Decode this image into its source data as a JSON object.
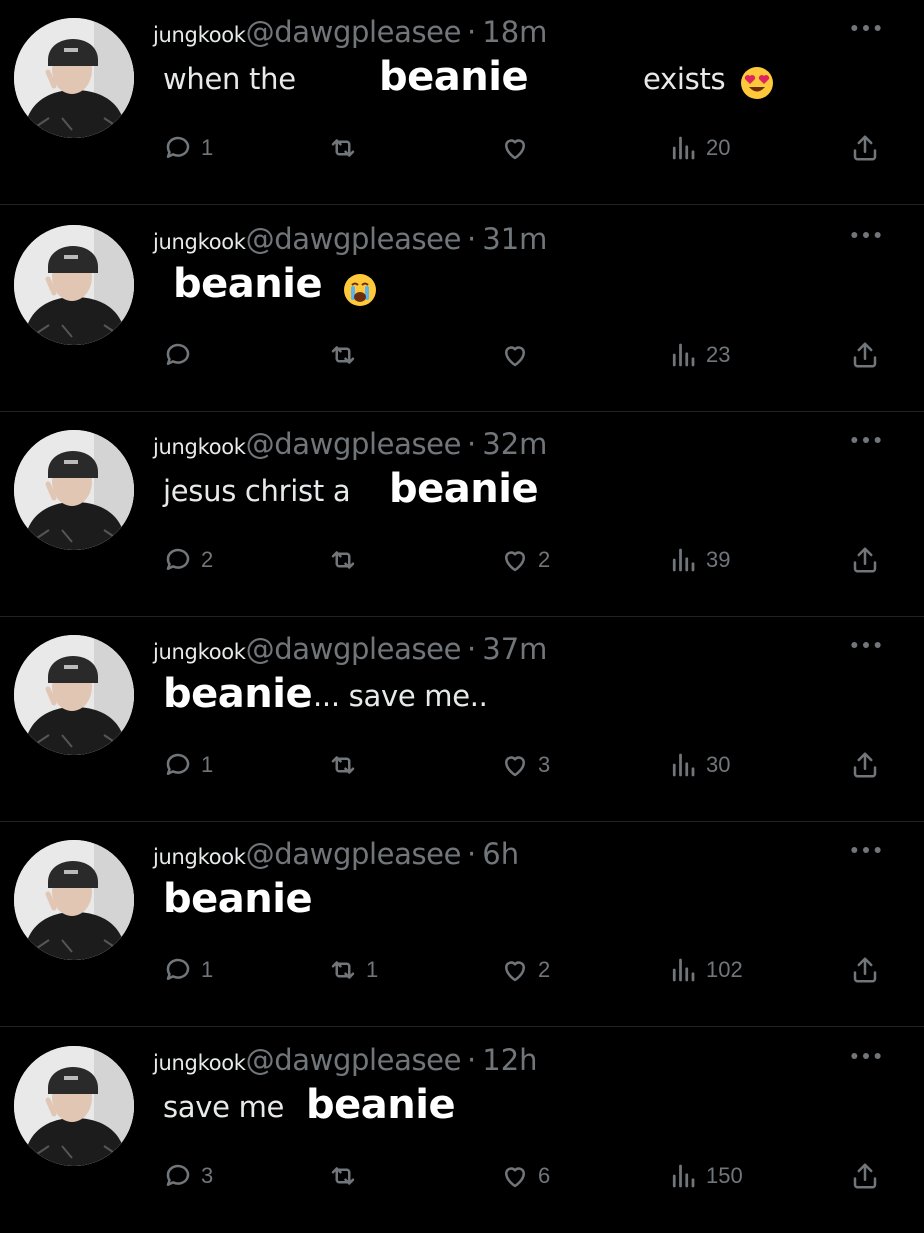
{
  "tweets": [
    {
      "name": "jungkook",
      "handle": "@dawgpleasee",
      "sep": "·",
      "time": "18m",
      "replies": "1",
      "retweets": "",
      "likes": "",
      "views": "20",
      "parts": [
        "when the",
        "beanie",
        "exists"
      ],
      "emoji": "heart-eyes-emoji"
    },
    {
      "name": "jungkook",
      "handle": "@dawgpleasee",
      "sep": "·",
      "time": "31m",
      "replies": "",
      "retweets": "",
      "likes": "",
      "views": "23",
      "parts": [
        "beanie"
      ],
      "emoji": "crying-emoji"
    },
    {
      "name": "jungkook",
      "handle": "@dawgpleasee",
      "sep": "·",
      "time": "32m",
      "replies": "2",
      "retweets": "",
      "likes": "2",
      "views": "39",
      "parts": [
        "jesus christ a",
        "beanie"
      ]
    },
    {
      "name": "jungkook",
      "handle": "@dawgpleasee",
      "sep": "·",
      "time": "37m",
      "replies": "1",
      "retweets": "",
      "likes": "3",
      "views": "30",
      "parts": [
        "beanie",
        "... save me.."
      ]
    },
    {
      "name": "jungkook",
      "handle": "@dawgpleasee",
      "sep": "·",
      "time": "6h",
      "replies": "1",
      "retweets": "1",
      "likes": "2",
      "views": "102",
      "parts": [
        "beanie"
      ]
    },
    {
      "name": "jungkook",
      "handle": "@dawgpleasee",
      "sep": "·",
      "time": "12h",
      "replies": "3",
      "retweets": "",
      "likes": "6",
      "views": "150",
      "parts": [
        "save me",
        "beanie"
      ]
    }
  ],
  "colors": {
    "background": "#000000",
    "muted": "#71767b",
    "text": "#e7e9ea",
    "bold_overlay": "#ffffff"
  },
  "icons": {
    "reply": "reply-icon",
    "retweet": "retweet-icon",
    "like": "heart-icon",
    "views": "views-icon",
    "share": "share-icon",
    "more": "more-icon"
  }
}
